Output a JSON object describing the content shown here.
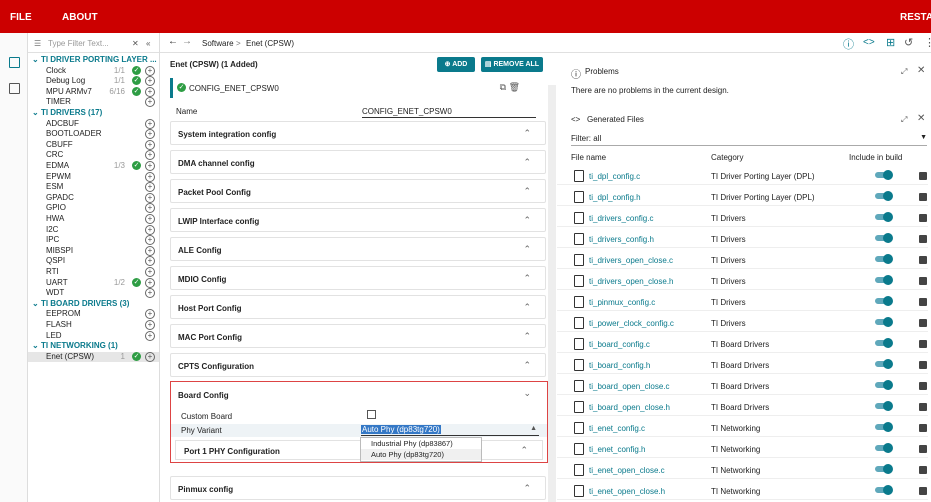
{
  "topbar": {
    "file": "FILE",
    "about": "ABOUT",
    "restart": "RESTAR"
  },
  "sidebar": {
    "filter_placeholder": "Type Filter Text...",
    "tree": [
      {
        "kind": "cat",
        "label": "TI DRIVER PORTING LAYER ..."
      },
      {
        "kind": "it",
        "label": "Clock",
        "count": "1/1",
        "ok": true
      },
      {
        "kind": "it",
        "label": "Debug Log",
        "count": "1/1",
        "ok": true
      },
      {
        "kind": "it",
        "label": "MPU ARMv7",
        "count": "6/16",
        "ok": true
      },
      {
        "kind": "it",
        "label": "TIMER"
      },
      {
        "kind": "cat",
        "label": "TI DRIVERS (17)"
      },
      {
        "kind": "it",
        "label": "ADCBUF"
      },
      {
        "kind": "it",
        "label": "BOOTLOADER"
      },
      {
        "kind": "it",
        "label": "CBUFF"
      },
      {
        "kind": "it",
        "label": "CRC"
      },
      {
        "kind": "it",
        "label": "EDMA",
        "count": "1/3",
        "ok": true
      },
      {
        "kind": "it",
        "label": "EPWM"
      },
      {
        "kind": "it",
        "label": "ESM"
      },
      {
        "kind": "it",
        "label": "GPADC"
      },
      {
        "kind": "it",
        "label": "GPIO"
      },
      {
        "kind": "it",
        "label": "HWA"
      },
      {
        "kind": "it",
        "label": "I2C"
      },
      {
        "kind": "it",
        "label": "IPC"
      },
      {
        "kind": "it",
        "label": "MIBSPI"
      },
      {
        "kind": "it",
        "label": "QSPI"
      },
      {
        "kind": "it",
        "label": "RTI"
      },
      {
        "kind": "it",
        "label": "UART",
        "count": "1/2",
        "ok": true
      },
      {
        "kind": "it",
        "label": "WDT"
      },
      {
        "kind": "cat",
        "label": "TI BOARD DRIVERS (3)"
      },
      {
        "kind": "it",
        "label": "EEPROM"
      },
      {
        "kind": "it",
        "label": "FLASH"
      },
      {
        "kind": "it",
        "label": "LED"
      },
      {
        "kind": "cat",
        "label": "TI NETWORKING (1)"
      },
      {
        "kind": "it",
        "label": "Enet (CPSW)",
        "count": "1",
        "ok": true,
        "selected": true
      }
    ]
  },
  "breadcrumb": {
    "software": "Software",
    "sep": ">",
    "current": "Enet (CPSW)"
  },
  "config": {
    "title": "Enet (CPSW) (1 Added)",
    "add": "ADD",
    "remove_all": "REMOVE ALL",
    "instance": "CONFIG_ENET_CPSW0",
    "name_label": "Name",
    "name_value": "CONFIG_ENET_CPSW0",
    "sections": [
      "System integration config",
      "DMA channel config",
      "Packet Pool Config",
      "LWIP Interface config",
      "ALE Config",
      "MDIO Config",
      "Host Port Config",
      "MAC Port Config",
      "CPTS Configuration"
    ],
    "board": {
      "title": "Board Config",
      "custom_board": "Custom Board",
      "phy_variant": "Phy Variant",
      "phy_selected": "Auto Phy (dp83tg720)",
      "options": [
        "Industrial Phy (dp83867)",
        "Auto Phy (dp83tg720)"
      ],
      "port1": "Port 1 PHY Configuration"
    },
    "pinmux": "Pinmux config"
  },
  "problems": {
    "title": "Problems",
    "message": "There are no problems in the current design."
  },
  "generated": {
    "title": "Generated Files",
    "filter_label": "Filter:",
    "filter_value": "all",
    "headers": [
      "File name",
      "Category",
      "Include in build"
    ],
    "rows": [
      [
        "ti_dpl_config.c",
        "TI Driver Porting Layer (DPL)"
      ],
      [
        "ti_dpl_config.h",
        "TI Driver Porting Layer (DPL)"
      ],
      [
        "ti_drivers_config.c",
        "TI Drivers"
      ],
      [
        "ti_drivers_config.h",
        "TI Drivers"
      ],
      [
        "ti_drivers_open_close.c",
        "TI Drivers"
      ],
      [
        "ti_drivers_open_close.h",
        "TI Drivers"
      ],
      [
        "ti_pinmux_config.c",
        "TI Drivers"
      ],
      [
        "ti_power_clock_config.c",
        "TI Drivers"
      ],
      [
        "ti_board_config.c",
        "TI Board Drivers"
      ],
      [
        "ti_board_config.h",
        "TI Board Drivers"
      ],
      [
        "ti_board_open_close.c",
        "TI Board Drivers"
      ],
      [
        "ti_board_open_close.h",
        "TI Board Drivers"
      ],
      [
        "ti_enet_config.c",
        "TI Networking"
      ],
      [
        "ti_enet_config.h",
        "TI Networking"
      ],
      [
        "ti_enet_open_close.c",
        "TI Networking"
      ],
      [
        "ti_enet_open_close.h",
        "TI Networking"
      ]
    ]
  },
  "colors": {
    "brand": "#cc0000",
    "accent": "#0a7a8c",
    "ok": "#2e9d44"
  }
}
